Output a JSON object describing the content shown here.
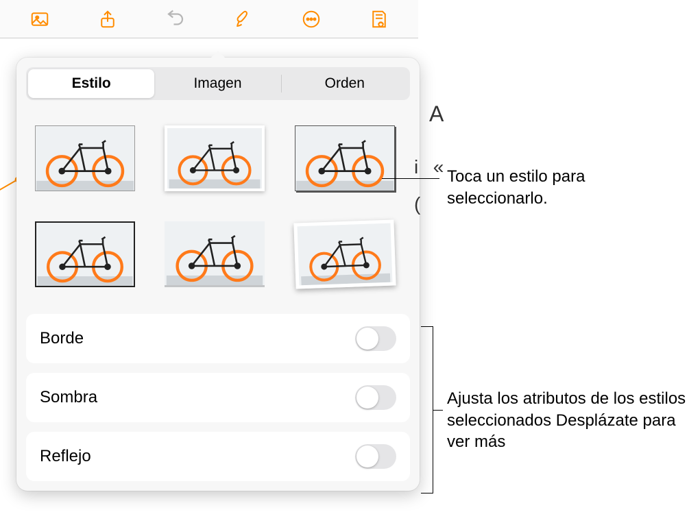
{
  "toolbar": {
    "icons": [
      "media-icon",
      "share-icon",
      "undo-icon",
      "format-brush-icon",
      "more-icon",
      "document-view-icon"
    ]
  },
  "panel": {
    "tabs": [
      "Estilo",
      "Imagen",
      "Orden"
    ],
    "active_tab": 0,
    "style_thumbs": [
      {
        "name": "style-1"
      },
      {
        "name": "style-2"
      },
      {
        "name": "style-3"
      },
      {
        "name": "style-4"
      },
      {
        "name": "style-5"
      },
      {
        "name": "style-6"
      }
    ],
    "options": [
      {
        "label": "Borde",
        "value": false
      },
      {
        "label": "Sombra",
        "value": false
      },
      {
        "label": "Reflejo",
        "value": false
      }
    ]
  },
  "annotations": {
    "callout1": "Toca un estilo para seleccionarlo.",
    "callout2": "Ajusta los atributos de los estilos seleccionados Desplázate para ver más"
  }
}
